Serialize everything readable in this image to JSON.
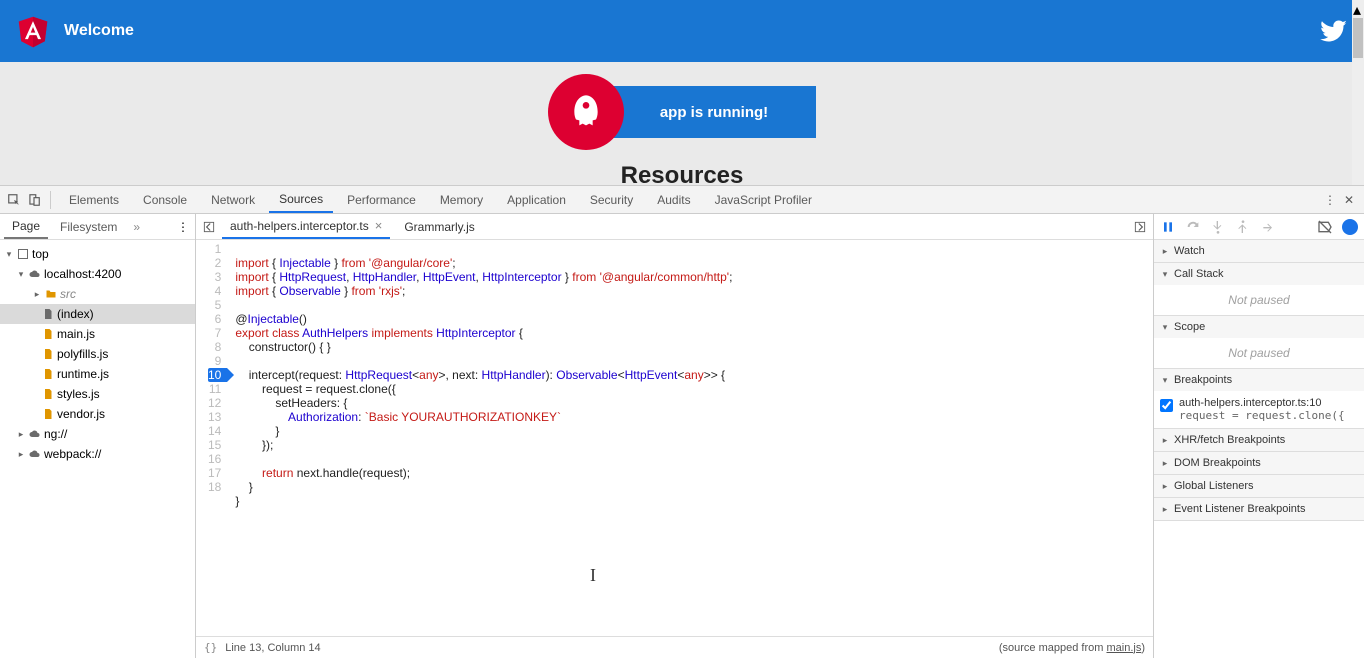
{
  "app": {
    "title": "Welcome",
    "running_text": "app is running!",
    "resources_heading": "Resources"
  },
  "devtools": {
    "tabs": [
      "Elements",
      "Console",
      "Network",
      "Sources",
      "Performance",
      "Memory",
      "Application",
      "Security",
      "Audits",
      "JavaScript Profiler"
    ],
    "active_tab": "Sources",
    "navigator": {
      "tabs": [
        "Page",
        "Filesystem"
      ],
      "active": "Page",
      "tree": {
        "top": "top",
        "host": "localhost:4200",
        "folder": "src",
        "index": "(index)",
        "files": [
          "main.js",
          "polyfills.js",
          "runtime.js",
          "styles.js",
          "vendor.js"
        ],
        "extra1": "ng://",
        "extra2": "webpack://"
      }
    },
    "editor": {
      "tabs": [
        "auth-helpers.interceptor.ts",
        "Grammarly.js"
      ],
      "active": "auth-helpers.interceptor.ts",
      "status_left": "Line 13, Column 14",
      "status_right_prefix": "(source mapped from ",
      "status_right_link": "main.js",
      "status_right_suffix": ")"
    },
    "debugger": {
      "panes": {
        "watch": "Watch",
        "callstack": "Call Stack",
        "scope": "Scope",
        "breakpoints": "Breakpoints",
        "xhr": "XHR/fetch Breakpoints",
        "dom": "DOM Breakpoints",
        "global": "Global Listeners",
        "event": "Event Listener Breakpoints"
      },
      "not_paused": "Not paused",
      "bp_file": "auth-helpers.interceptor.ts:10",
      "bp_code": "request = request.clone({"
    }
  }
}
